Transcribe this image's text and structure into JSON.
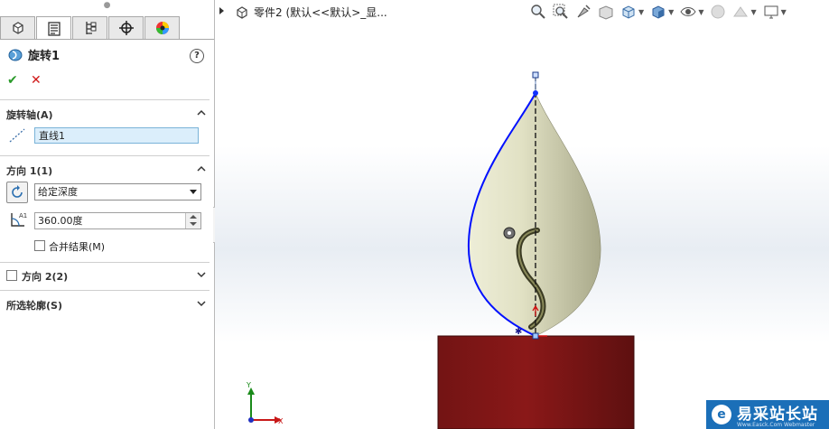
{
  "property_manager": {
    "tabs": [
      "feature-manager-icon",
      "property-manager-icon",
      "configuration-manager-icon",
      "dimxpert-icon",
      "display-manager-icon"
    ],
    "feature_title": "旋转1",
    "help": "?",
    "ok": "✔",
    "cancel": "✕",
    "axis_section": {
      "title": "旋转轴(A)",
      "value": "直线1"
    },
    "direction1": {
      "title": "方向 1(1)",
      "end_condition": "给定深度",
      "angle": "360.00度",
      "merge_label": "合并结果(M)",
      "merge_checked": false
    },
    "direction2": {
      "title": "方向 2(2)",
      "checked": false
    },
    "selected_contours": {
      "title": "所选轮廓(S)"
    }
  },
  "viewport": {
    "tree_label": "零件2  (默认<<默认>_显...",
    "heads_up_icons": [
      "zoom-to-fit-icon",
      "zoom-to-area-icon",
      "previous-view-icon",
      "section-view-icon",
      "view-orientation-icon",
      "display-style-icon",
      "hide-show-items-icon",
      "edit-appearance-icon",
      "apply-scene-icon",
      "view-settings-icon"
    ],
    "triad": {
      "x": "X",
      "y": "Y"
    }
  },
  "watermark": {
    "text": "易采站长站",
    "sub": "Www.Easck.Com Webmaster"
  },
  "colors": {
    "profile": "#0000ff",
    "body": "#d6d6b4",
    "base": "#7a1414",
    "selection": "#dbeefb"
  }
}
